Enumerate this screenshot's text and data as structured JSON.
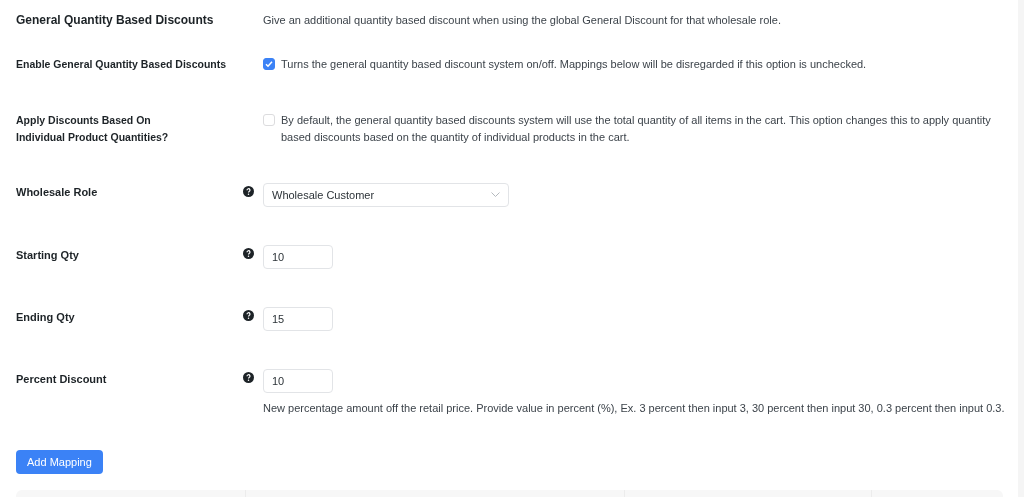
{
  "rows": [
    {
      "kind": "heading",
      "label": "General Quantity Based Discounts",
      "description": "Give an additional quantity based discount when using the global General Discount for that wholesale role."
    },
    {
      "kind": "checkbox",
      "label": "Enable General Quantity Based Discounts",
      "checked": true,
      "description": "Turns the general quantity based discount system on/off. Mappings below will be disregarded if this option is unchecked."
    },
    {
      "kind": "checkbox",
      "label": "Apply Discounts Based On Individual Product Quantities?",
      "checked": false,
      "description": "By default, the general quantity based discounts system will use the total quantity of all items in the cart. This option changes this to apply quantity based discounts based on the quantity of individual products in the cart."
    },
    {
      "kind": "select",
      "label": "Wholesale Role",
      "value": "Wholesale Customer"
    },
    {
      "kind": "number",
      "label": "Starting Qty",
      "value": "10"
    },
    {
      "kind": "number",
      "label": "Ending Qty",
      "value": "15"
    },
    {
      "kind": "number",
      "label": "Percent Discount",
      "value": "10",
      "description": "New percentage amount off the retail price. Provide value in percent (%), Ex. 3 percent then input 3, 30 percent then input 30, 0.3 percent then input 0.3."
    }
  ],
  "add_button": "Add Mapping"
}
